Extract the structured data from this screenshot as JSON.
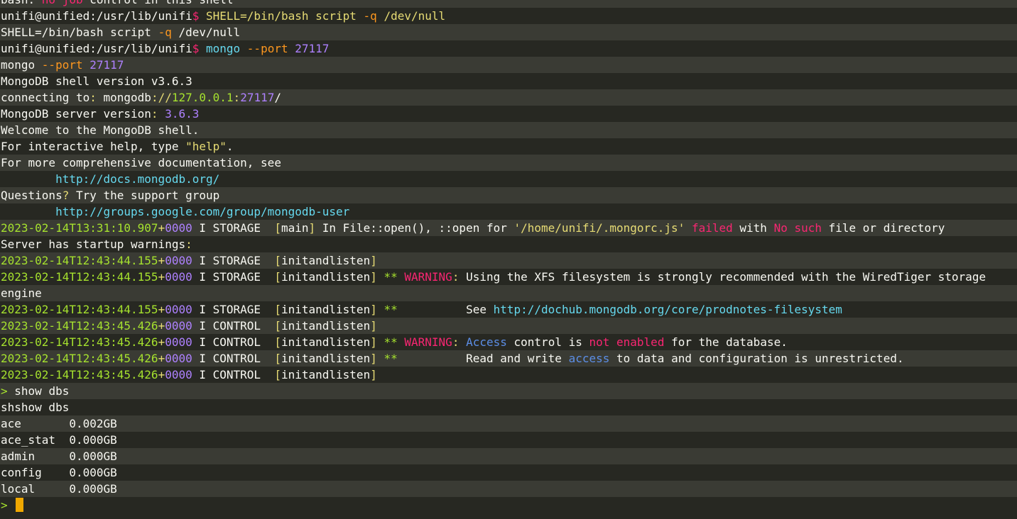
{
  "colors": {
    "background": "#272822",
    "background_alt": "#3a3b34",
    "text": "#f8f8f2",
    "red": "#f92672",
    "green": "#a6e22e",
    "yellow": "#e6db74",
    "purple": "#ae81ff",
    "cyan": "#66d9ef",
    "blue": "#5c8ee6",
    "orange": "#fd971f",
    "cursor": "#f0a800"
  },
  "lines": [
    [
      {
        "t": "bash: ",
        "c": "text"
      },
      {
        "t": "no job",
        "c": "red"
      },
      {
        "t": " control in this shell",
        "c": "text"
      }
    ],
    [
      {
        "t": "unifi@unified:/usr/lib/unifi",
        "c": "text"
      },
      {
        "t": "$",
        "c": "red"
      },
      {
        "t": " SHELL=/bin/bash script ",
        "c": "yellow"
      },
      {
        "t": "-q",
        "c": "orange"
      },
      {
        "t": " /dev/null",
        "c": "yellow"
      }
    ],
    [
      {
        "t": "SHELL=/bin/bash script ",
        "c": "text"
      },
      {
        "t": "-q",
        "c": "orange"
      },
      {
        "t": " /dev/null",
        "c": "text"
      }
    ],
    [
      {
        "t": "unifi@unified:/usr/lib/unifi",
        "c": "text"
      },
      {
        "t": "$",
        "c": "red"
      },
      {
        "t": " mongo ",
        "c": "cyan"
      },
      {
        "t": "--port",
        "c": "orange"
      },
      {
        "t": " 27117",
        "c": "purple"
      }
    ],
    [
      {
        "t": "mongo ",
        "c": "text"
      },
      {
        "t": "--port",
        "c": "orange"
      },
      {
        "t": " 27117",
        "c": "purple"
      }
    ],
    [
      {
        "t": "MongoDB shell version v3.6.3",
        "c": "text"
      }
    ],
    [
      {
        "t": "connecting to",
        "c": "text"
      },
      {
        "t": ":",
        "c": "yellow"
      },
      {
        "t": " mongodb",
        "c": "text"
      },
      {
        "t": "://",
        "c": "yellow"
      },
      {
        "t": "127.0.0.1",
        "c": "green"
      },
      {
        "t": ":",
        "c": "yellow"
      },
      {
        "t": "27117",
        "c": "purple"
      },
      {
        "t": "/",
        "c": "text"
      }
    ],
    [
      {
        "t": "MongoDB server version",
        "c": "text"
      },
      {
        "t": ":",
        "c": "yellow"
      },
      {
        "t": " 3.6.3",
        "c": "purple"
      }
    ],
    [
      {
        "t": "Welcome to the MongoDB shell.",
        "c": "text"
      }
    ],
    [
      {
        "t": "For interactive help, type ",
        "c": "text"
      },
      {
        "t": "\"help\"",
        "c": "yellow"
      },
      {
        "t": ".",
        "c": "text"
      }
    ],
    [
      {
        "t": "For more comprehensive documentation, see",
        "c": "text"
      }
    ],
    [
      {
        "t": "        ",
        "c": "text"
      },
      {
        "t": "http://docs.mongodb.org/",
        "c": "cyan"
      }
    ],
    [
      {
        "t": "Questions",
        "c": "text"
      },
      {
        "t": "?",
        "c": "yellow"
      },
      {
        "t": " Try the support group",
        "c": "text"
      }
    ],
    [
      {
        "t": "        ",
        "c": "text"
      },
      {
        "t": "http://groups.google.com/group/mongodb-user",
        "c": "cyan"
      }
    ],
    [
      {
        "t": "2023-02-14T13:31:10.907",
        "c": "green"
      },
      {
        "t": "+",
        "c": "yellow"
      },
      {
        "t": "0000",
        "c": "purple"
      },
      {
        "t": " I STORAGE  ",
        "c": "text"
      },
      {
        "t": "[",
        "c": "yellow"
      },
      {
        "t": "main",
        "c": "text"
      },
      {
        "t": "]",
        "c": "yellow"
      },
      {
        "t": " In File::open(), ::open for ",
        "c": "text"
      },
      {
        "t": "'/home/unifi/.mongorc.js'",
        "c": "yellow"
      },
      {
        "t": " ",
        "c": "text"
      },
      {
        "t": "failed",
        "c": "red"
      },
      {
        "t": " with ",
        "c": "text"
      },
      {
        "t": "No such",
        "c": "red"
      },
      {
        "t": " file or directory",
        "c": "text"
      }
    ],
    [
      {
        "t": "Server has startup warnings",
        "c": "text"
      },
      {
        "t": ":",
        "c": "yellow"
      }
    ],
    [
      {
        "t": "2023-02-14T12:43:44.155",
        "c": "green"
      },
      {
        "t": "+",
        "c": "yellow"
      },
      {
        "t": "0000",
        "c": "purple"
      },
      {
        "t": " I STORAGE  ",
        "c": "text"
      },
      {
        "t": "[",
        "c": "yellow"
      },
      {
        "t": "initandlisten",
        "c": "text"
      },
      {
        "t": "]",
        "c": "yellow"
      }
    ],
    [
      {
        "t": "2023-02-14T12:43:44.155",
        "c": "green"
      },
      {
        "t": "+",
        "c": "yellow"
      },
      {
        "t": "0000",
        "c": "purple"
      },
      {
        "t": " I STORAGE  ",
        "c": "text"
      },
      {
        "t": "[",
        "c": "yellow"
      },
      {
        "t": "initandlisten",
        "c": "text"
      },
      {
        "t": "]",
        "c": "yellow"
      },
      {
        "t": " **",
        "c": "green"
      },
      {
        "t": " WARNING",
        "c": "red"
      },
      {
        "t": ":",
        "c": "yellow"
      },
      {
        "t": " Using the XFS filesystem is strongly recommended with the WiredTiger storage",
        "c": "text"
      }
    ],
    [
      {
        "t": "engine",
        "c": "text"
      }
    ],
    [
      {
        "t": "2023-02-14T12:43:44.155",
        "c": "green"
      },
      {
        "t": "+",
        "c": "yellow"
      },
      {
        "t": "0000",
        "c": "purple"
      },
      {
        "t": " I STORAGE  ",
        "c": "text"
      },
      {
        "t": "[",
        "c": "yellow"
      },
      {
        "t": "initandlisten",
        "c": "text"
      },
      {
        "t": "]",
        "c": "yellow"
      },
      {
        "t": " **",
        "c": "green"
      },
      {
        "t": "          See ",
        "c": "text"
      },
      {
        "t": "http://dochub.mongodb.org/core/prodnotes-filesystem",
        "c": "cyan"
      }
    ],
    [
      {
        "t": "2023-02-14T12:43:45.426",
        "c": "green"
      },
      {
        "t": "+",
        "c": "yellow"
      },
      {
        "t": "0000",
        "c": "purple"
      },
      {
        "t": " I CONTROL  ",
        "c": "text"
      },
      {
        "t": "[",
        "c": "yellow"
      },
      {
        "t": "initandlisten",
        "c": "text"
      },
      {
        "t": "]",
        "c": "yellow"
      }
    ],
    [
      {
        "t": "2023-02-14T12:43:45.426",
        "c": "green"
      },
      {
        "t": "+",
        "c": "yellow"
      },
      {
        "t": "0000",
        "c": "purple"
      },
      {
        "t": " I CONTROL  ",
        "c": "text"
      },
      {
        "t": "[",
        "c": "yellow"
      },
      {
        "t": "initandlisten",
        "c": "text"
      },
      {
        "t": "]",
        "c": "yellow"
      },
      {
        "t": " **",
        "c": "green"
      },
      {
        "t": " WARNING",
        "c": "red"
      },
      {
        "t": ":",
        "c": "yellow"
      },
      {
        "t": " ",
        "c": "text"
      },
      {
        "t": "Access",
        "c": "blue"
      },
      {
        "t": " control is ",
        "c": "text"
      },
      {
        "t": "not enabled",
        "c": "red"
      },
      {
        "t": " for the database.",
        "c": "text"
      }
    ],
    [
      {
        "t": "2023-02-14T12:43:45.426",
        "c": "green"
      },
      {
        "t": "+",
        "c": "yellow"
      },
      {
        "t": "0000",
        "c": "purple"
      },
      {
        "t": " I CONTROL  ",
        "c": "text"
      },
      {
        "t": "[",
        "c": "yellow"
      },
      {
        "t": "initandlisten",
        "c": "text"
      },
      {
        "t": "]",
        "c": "yellow"
      },
      {
        "t": " **",
        "c": "green"
      },
      {
        "t": "          Read and write ",
        "c": "text"
      },
      {
        "t": "access",
        "c": "blue"
      },
      {
        "t": " to data and configuration is unrestricted.",
        "c": "text"
      }
    ],
    [
      {
        "t": "2023-02-14T12:43:45.426",
        "c": "green"
      },
      {
        "t": "+",
        "c": "yellow"
      },
      {
        "t": "0000",
        "c": "purple"
      },
      {
        "t": " I CONTROL  ",
        "c": "text"
      },
      {
        "t": "[",
        "c": "yellow"
      },
      {
        "t": "initandlisten",
        "c": "text"
      },
      {
        "t": "]",
        "c": "yellow"
      }
    ],
    [
      {
        "t": ">",
        "c": "green"
      },
      {
        "t": " show dbs",
        "c": "text"
      }
    ],
    [
      {
        "t": "shshow dbs",
        "c": "text"
      }
    ],
    [
      {
        "t": "ace       0.002GB",
        "c": "text"
      }
    ],
    [
      {
        "t": "ace_stat  0.000GB",
        "c": "text"
      }
    ],
    [
      {
        "t": "admin     0.000GB",
        "c": "text"
      }
    ],
    [
      {
        "t": "config    0.000GB",
        "c": "text"
      }
    ],
    [
      {
        "t": "local     0.000GB",
        "c": "text"
      }
    ],
    [
      {
        "t": ">",
        "c": "green"
      }
    ]
  ]
}
